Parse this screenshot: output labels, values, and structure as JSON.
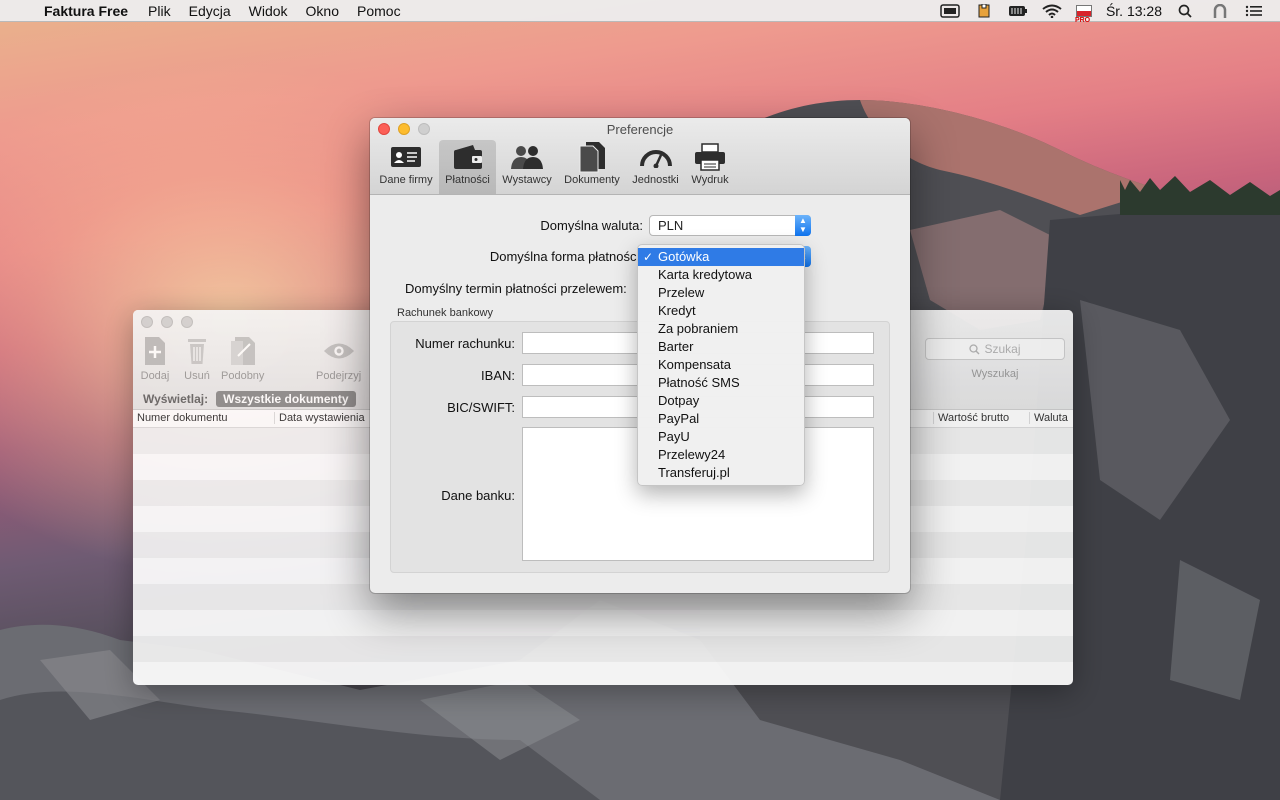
{
  "menubar": {
    "app_name": "Faktura Free",
    "menus": [
      "Plik",
      "Edycja",
      "Widok",
      "Okno",
      "Pomoc"
    ],
    "flag_badge": "PRO",
    "clock": "Śr. 13:28"
  },
  "bgwindow": {
    "toolbar": {
      "add": "Dodaj",
      "delete": "Usuń",
      "similar": "Podobny",
      "preview": "Podejrzyj",
      "search_placeholder": "Szukaj",
      "search_label": "Wyszukaj"
    },
    "filter": {
      "label": "Wyświetlaj:",
      "selected": "Wszystkie dokumenty",
      "right_text": "y"
    },
    "columns": [
      "Numer dokumentu",
      "Data wystawienia",
      "to",
      "Wartość brutto",
      "Waluta"
    ]
  },
  "preferences": {
    "title": "Preferencje",
    "tabs": [
      {
        "label": "Dane firmy"
      },
      {
        "label": "Płatności"
      },
      {
        "label": "Wystawcy"
      },
      {
        "label": "Dokumenty"
      },
      {
        "label": "Jednostki"
      },
      {
        "label": "Wydruk"
      }
    ],
    "currency_label": "Domyślna waluta:",
    "currency_value": "PLN",
    "payment_label": "Domyślna forma płatności:",
    "term_label": "Domyślny termin płatności przelewem:",
    "bank_group_title": "Rachunek bankowy",
    "account_label": "Numer rachunku:",
    "iban_label": "IBAN:",
    "bic_label": "BIC/SWIFT:",
    "bank_data_label": "Dane banku:"
  },
  "dropdown": {
    "selected_index": 0,
    "check": "✓",
    "options": [
      "Gotówka",
      "Karta kredytowa",
      "Przelew",
      "Kredyt",
      "Za pobraniem",
      "Barter",
      "Kompensata",
      "Płatność SMS",
      "Dotpay",
      "PayPal",
      "PayU",
      "Przelewy24",
      "Transferuj.pl"
    ]
  }
}
